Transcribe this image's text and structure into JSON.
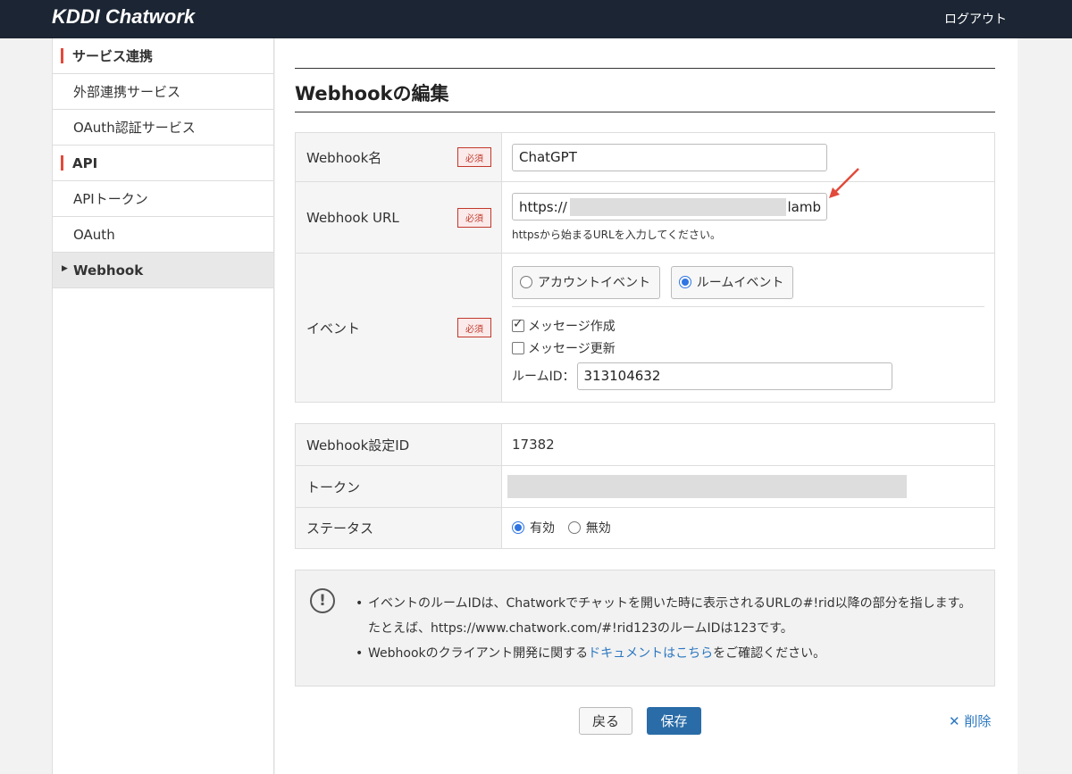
{
  "header": {
    "logo": "KDDI Chatwork",
    "logout": "ログアウト"
  },
  "sidebar": {
    "items": [
      {
        "label": "サービス連携"
      },
      {
        "label": "外部連携サービス"
      },
      {
        "label": "OAuth認証サービス"
      },
      {
        "label": "API"
      },
      {
        "label": "APIトークン"
      },
      {
        "label": "OAuth"
      },
      {
        "label": "Webhook"
      }
    ]
  },
  "page": {
    "title": "Webhookの編集"
  },
  "form": {
    "required": "必須",
    "name_label": "Webhook名",
    "name_value": "ChatGPT",
    "url_label": "Webhook URL",
    "url_prefix": "https://",
    "url_suffix": "lamb",
    "url_hint": "httpsから始まるURLを入力してください。",
    "event_label": "イベント",
    "event_account": "アカウントイベント",
    "event_room": "ルームイベント",
    "msg_create": "メッセージ作成",
    "msg_update": "メッセージ更新",
    "room_id_label": "ルームID：",
    "room_id_value": "313104632"
  },
  "info": {
    "id_label": "Webhook設定ID",
    "id_value": "17382",
    "token_label": "トークン",
    "status_label": "ステータス",
    "status_on": "有効",
    "status_off": "無効"
  },
  "note": {
    "line1": "イベントのルームIDは、Chatworkでチャットを開いた時に表示されるURLの#!rid以降の部分を指します。たとえば、https://www.chatwork.com/#!rid123のルームIDは123です。",
    "line2_pre": "Webhookのクライアント開発に関する",
    "line2_link": "ドキュメントはこちら",
    "line2_post": "をご確認ください。"
  },
  "actions": {
    "back": "戻る",
    "save": "保存",
    "delete": "削除"
  },
  "colors": {
    "header_bg": "#1b2533",
    "accent_red": "#e24a3b",
    "primary": "#2a6ca7",
    "link": "#2b77c0"
  }
}
